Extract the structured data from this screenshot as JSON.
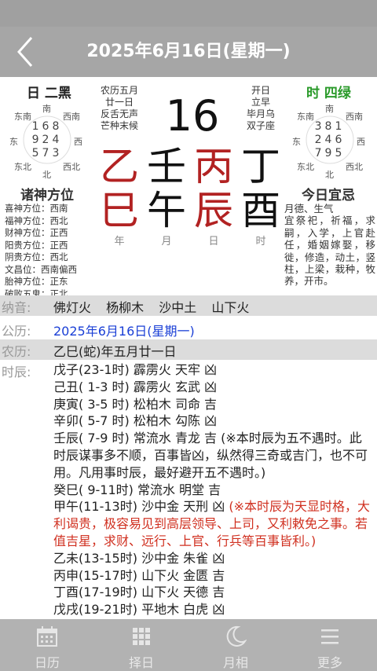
{
  "header": {
    "title": "2025年6月16日(星期一)"
  },
  "left_star": "日 二黑",
  "right_star": "时 四绿",
  "left_compass": {
    "dirs": [
      "东南",
      "南",
      "西南",
      "东",
      "西",
      "东北",
      "北",
      "西北"
    ],
    "rows": [
      "168",
      "924",
      "573"
    ]
  },
  "right_compass": {
    "dirs": [
      "东南",
      "南",
      "西南",
      "东",
      "西",
      "东北",
      "北",
      "西北"
    ],
    "rows": [
      "381",
      "246",
      "795"
    ]
  },
  "info_left": [
    "农历五月",
    "廿一日",
    "反舌无声",
    "芒种末候"
  ],
  "info_right": [
    "开日",
    "立早",
    "毕月乌",
    "双子座"
  ],
  "day_number": "16",
  "ganzhi": {
    "top": [
      "乙",
      "壬",
      "丙",
      "丁"
    ],
    "bottom": [
      "巳",
      "午",
      "辰",
      "酉"
    ],
    "labels": [
      "年",
      "月",
      "日",
      "时"
    ]
  },
  "zhushen": {
    "title": "诸神方位",
    "items": [
      "喜神方位：西南",
      "福神方位：西北",
      "财神方位：正西",
      "阳贵方位：正西",
      "阴贵方位：西北",
      "文昌位：西南偏西",
      "胎神方位：正东",
      "破败五鬼：正北"
    ]
  },
  "yiji": {
    "title": "今日宜忌",
    "text": "月德、生气\n宜祭祀，祈福，求嗣，入学，上官赴任，婚姻嫁娶，移徙，修造，动土，竖柱，上梁，栽种，牧养，开市。"
  },
  "nayin": {
    "label": "纳音:",
    "values": [
      "佛灯火",
      "杨柳木",
      "沙中土",
      "山下火"
    ]
  },
  "gongli": {
    "label": "公历:",
    "value": "2025年6月16日(星期一)"
  },
  "nongli": {
    "label": "农历:",
    "value": "乙巳(蛇)年五月廿一日"
  },
  "shichen": {
    "label": "时辰:",
    "lines": [
      {
        "text": "戊子(23-1时) 霹雳火 天牢 凶",
        "note": "",
        "red": false
      },
      {
        "text": "己丑( 1-3 时) 霹雳火 玄武 凶",
        "note": "",
        "red": false
      },
      {
        "text": "庚寅( 3-5 时) 松柏木 司命 吉",
        "note": "",
        "red": false
      },
      {
        "text": "辛卯( 5-7 时) 松柏木 勾陈 凶",
        "note": "",
        "red": false
      },
      {
        "text": "壬辰( 7-9 时) 常流水 青龙 吉",
        "note": "(※本时辰为五不遇时。此时辰谋事多不顺，百事皆凶，纵然得三奇或吉门，也不可用。凡用事时辰，最好避开五不遇时。)",
        "red": false
      },
      {
        "text": "癸巳( 9-11时) 常流水 明堂 吉",
        "note": "",
        "red": false
      },
      {
        "text": "甲午(11-13时) 沙中金 天刑 凶",
        "note": "(※本时辰为天显时格，大利谒贵，极容易见到高层领导、上司，又利敕免之事。若值吉星，求财、远行、上官、行兵等百事皆利。)",
        "red": true
      },
      {
        "text": "乙未(13-15时) 沙中金 朱雀 凶",
        "note": "",
        "red": false
      },
      {
        "text": "丙申(15-17时) 山下火 金匮 吉",
        "note": "",
        "red": false
      },
      {
        "text": "丁酉(17-19时) 山下火 天德 吉",
        "note": "",
        "red": false
      },
      {
        "text": "戊戌(19-21时) 平地木 白虎 凶",
        "note": "",
        "red": false
      }
    ]
  },
  "tabs": [
    {
      "label": "日历",
      "icon": "calendar-icon"
    },
    {
      "label": "择日",
      "icon": "grid-icon"
    },
    {
      "label": "月相",
      "icon": "moon-icon"
    },
    {
      "label": "更多",
      "icon": "menu-icon"
    }
  ],
  "colors": {
    "header_bg": "#a6a6a6",
    "red": "#b22222",
    "green": "#2a9a2a",
    "blue": "#1a3fd6",
    "note_red": "#d03020"
  }
}
